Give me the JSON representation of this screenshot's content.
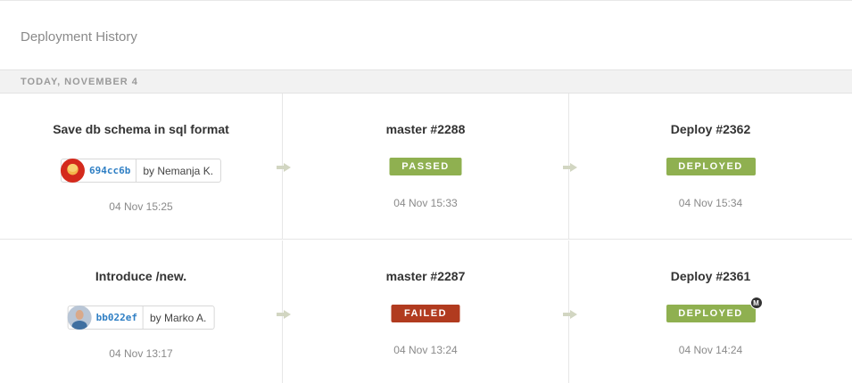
{
  "page": {
    "title": "Deployment History"
  },
  "day_group": {
    "label": "TODAY, NOVEMBER 4"
  },
  "rows": [
    {
      "commit": {
        "message": "Save db schema in sql format",
        "sha": "694cc6b",
        "author": "by Nemanja K.",
        "time": "04 Nov 15:25"
      },
      "build": {
        "name": "master #2288",
        "status": "PASSED",
        "time": "04 Nov 15:33"
      },
      "deploy": {
        "name": "Deploy #2362",
        "status": "DEPLOYED",
        "time": "04 Nov 15:34",
        "manual_mark": ""
      }
    },
    {
      "commit": {
        "message": "Introduce /new.",
        "sha": "bb022ef",
        "author": "by Marko A.",
        "time": "04 Nov 13:17"
      },
      "build": {
        "name": "master #2287",
        "status": "FAILED",
        "time": "04 Nov 13:24"
      },
      "deploy": {
        "name": "Deploy #2361",
        "status": "DEPLOYED",
        "time": "04 Nov 14:24",
        "manual_mark": "M"
      }
    }
  ],
  "colors": {
    "passed": "#8fb050",
    "failed": "#b13b1f",
    "deployed": "#8fb050",
    "sha_link": "#2f7fc4"
  }
}
